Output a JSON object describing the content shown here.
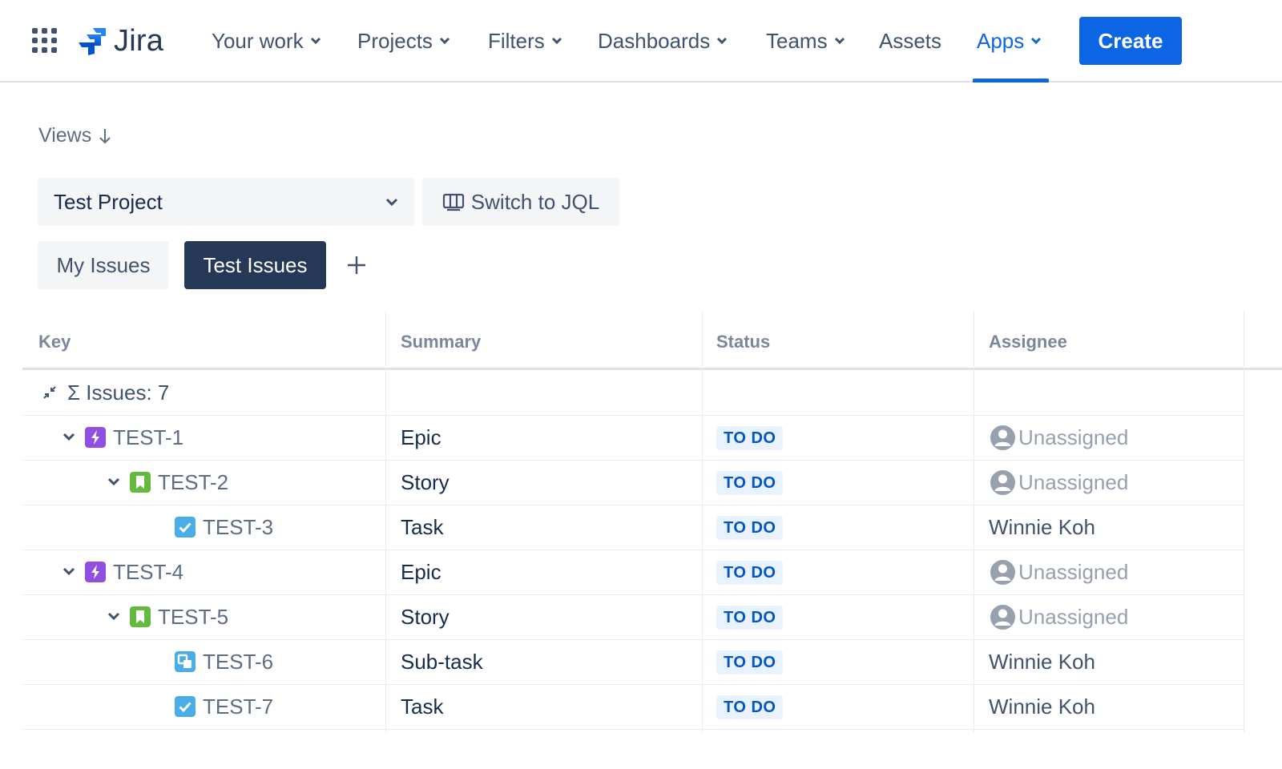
{
  "nav": {
    "logo": "Jira",
    "items": [
      {
        "label": "Your work"
      },
      {
        "label": "Projects"
      },
      {
        "label": "Filters"
      },
      {
        "label": "Dashboards"
      },
      {
        "label": "Teams"
      },
      {
        "label": "Assets"
      },
      {
        "label": "Apps"
      }
    ],
    "create_label": "Create"
  },
  "views_label": "Views",
  "project_select": {
    "value": "Test Project"
  },
  "jql_label": "Switch to JQL",
  "tabs": [
    {
      "label": "My Issues"
    },
    {
      "label": "Test Issues"
    }
  ],
  "table": {
    "columns": [
      "Key",
      "Summary",
      "Status",
      "Assignee"
    ],
    "summary": "Σ Issues: 7",
    "rows": [
      {
        "key": "TEST-1",
        "summary": "Epic",
        "status": "TO DO",
        "assignee": "Unassigned",
        "type": "epic-icon"
      },
      {
        "key": "TEST-2",
        "summary": "Story",
        "status": "TO DO",
        "assignee": "Unassigned",
        "type": "story-icon"
      },
      {
        "key": "TEST-3",
        "summary": "Task",
        "status": "TO DO",
        "assignee": "Winnie Koh",
        "type": "task-icon"
      },
      {
        "key": "TEST-4",
        "summary": "Epic",
        "status": "TO DO",
        "assignee": "Unassigned",
        "type": "epic-icon"
      },
      {
        "key": "TEST-5",
        "summary": "Story",
        "status": "TO DO",
        "assignee": "Unassigned",
        "type": "story-icon"
      },
      {
        "key": "TEST-6",
        "summary": "Sub-task",
        "status": "TO DO",
        "assignee": "Winnie Koh",
        "type": "subtask-icon"
      },
      {
        "key": "TEST-7",
        "summary": "Task",
        "status": "TO DO",
        "assignee": "Winnie Koh",
        "type": "task-icon"
      }
    ]
  },
  "colors": {
    "accent": "#0c66e4",
    "epic": "#904ee2",
    "story": "#63ba3c",
    "task": "#4bade8",
    "lozenge_bg": "#e9f2ff",
    "lozenge_text": "#0055cc"
  }
}
